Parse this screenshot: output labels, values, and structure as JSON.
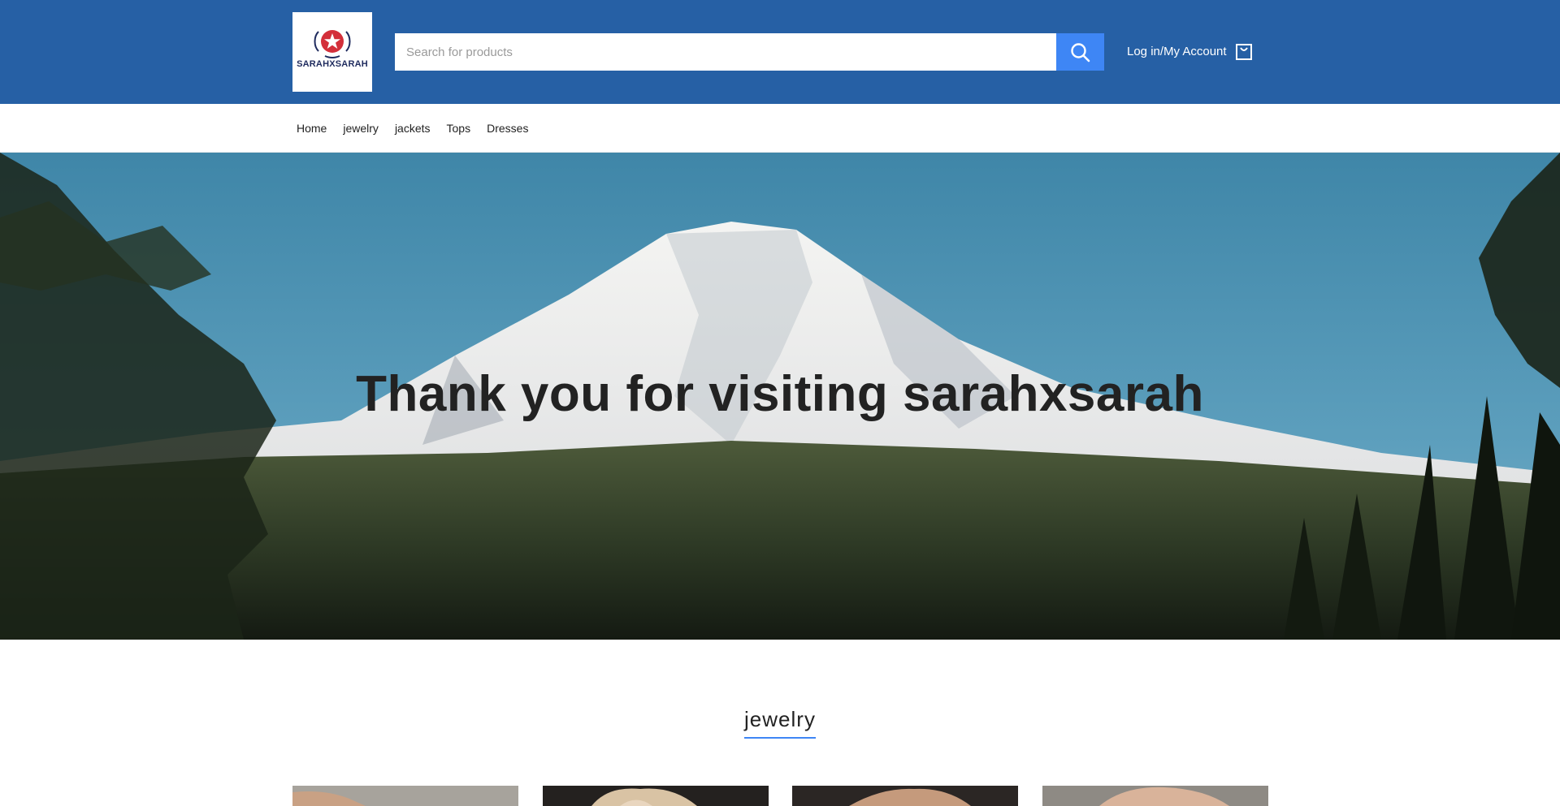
{
  "brand": {
    "logo_text": "SARAHXSARAH",
    "logo_icon": "star-emblem-icon"
  },
  "search": {
    "placeholder": "Search for products",
    "icon": "search-icon"
  },
  "account": {
    "label": "Log in/My Account",
    "cart_icon": "shopping-bag-icon"
  },
  "nav": [
    {
      "label": "Home"
    },
    {
      "label": "jewelry"
    },
    {
      "label": "jackets"
    },
    {
      "label": "Tops"
    },
    {
      "label": "Dresses"
    }
  ],
  "hero": {
    "title": "Thank you for visiting sarahxsarah"
  },
  "section": {
    "title": "jewelry"
  },
  "colors": {
    "header": "#2660a5",
    "accent": "#3e86f5",
    "logo_red": "#d32f3a",
    "logo_navy": "#1f2b5e"
  }
}
